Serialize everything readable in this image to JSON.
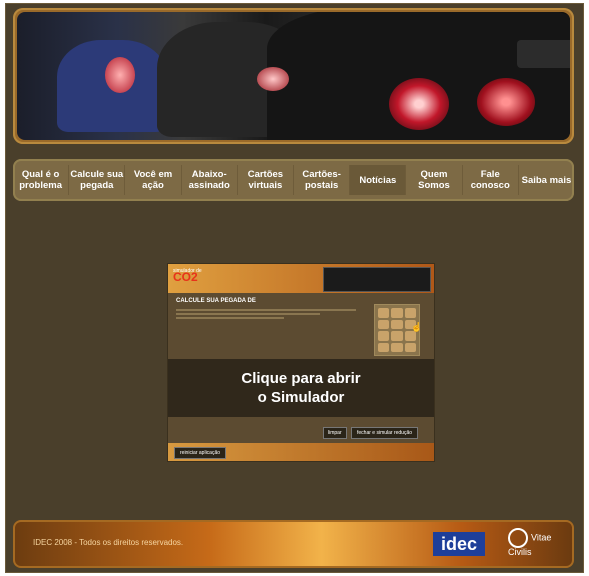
{
  "nav": {
    "items": [
      {
        "label": "Qual é o problema"
      },
      {
        "label": "Calcule sua pegada"
      },
      {
        "label": "Você em ação"
      },
      {
        "label": "Abaixo-assinado"
      },
      {
        "label": "Cartões virtuais"
      },
      {
        "label": "Cartões-postais"
      },
      {
        "label": "Notícias"
      },
      {
        "label": "Quem Somos"
      },
      {
        "label": "Fale conosco"
      },
      {
        "label": "Saiba mais"
      }
    ]
  },
  "simulator": {
    "logo_small": "simulador de",
    "logo_co2": "CO2",
    "title": "CALCULE SUA PEGADA DE",
    "overlay_text": "Clique para abrir o Simulador",
    "reset_label": "reiniciar aplicação",
    "limpar_label": "limpar",
    "simular_label": "fechar e simular redução"
  },
  "footer": {
    "copyright": "IDEC 2008 - Todos os direitos reservados.",
    "logo_idec": "idec",
    "logo_vitae": "Vitae Civilis"
  },
  "colors": {
    "background": "#4a3f2b",
    "nav": "#7d6a45",
    "accent": "#e8331a"
  }
}
